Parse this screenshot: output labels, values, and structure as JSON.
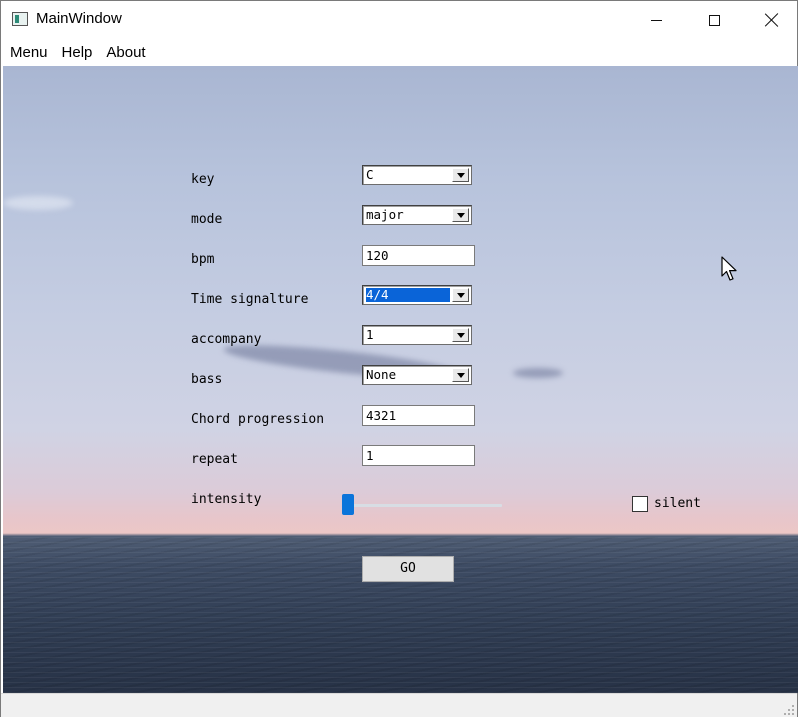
{
  "window": {
    "title": "MainWindow",
    "icons": {
      "app": "app-window-icon",
      "minimize": "minimize-icon",
      "maximize": "maximize-icon",
      "close": "close-icon"
    }
  },
  "menubar": {
    "items": [
      {
        "label": "Menu"
      },
      {
        "label": "Help"
      },
      {
        "label": "About"
      }
    ]
  },
  "form": {
    "key": {
      "label": "key",
      "value": "C"
    },
    "mode": {
      "label": "mode",
      "value": "major"
    },
    "bpm": {
      "label": "bpm",
      "value": "120"
    },
    "time_signature": {
      "label": "Time signalture",
      "value": "4/4"
    },
    "accompany": {
      "label": "accompany",
      "value": "1"
    },
    "bass": {
      "label": "bass",
      "value": "None"
    },
    "chord_progression": {
      "label": "Chord progression",
      "value": "4321"
    },
    "repeat": {
      "label": "repeat",
      "value": "1"
    },
    "intensity": {
      "label": "intensity",
      "level": 0
    },
    "silent": {
      "label": "silent",
      "checked": false
    },
    "go_label": "GO"
  },
  "colors": {
    "selection": "#0a64d8",
    "slider_handle": "#0b74da"
  }
}
